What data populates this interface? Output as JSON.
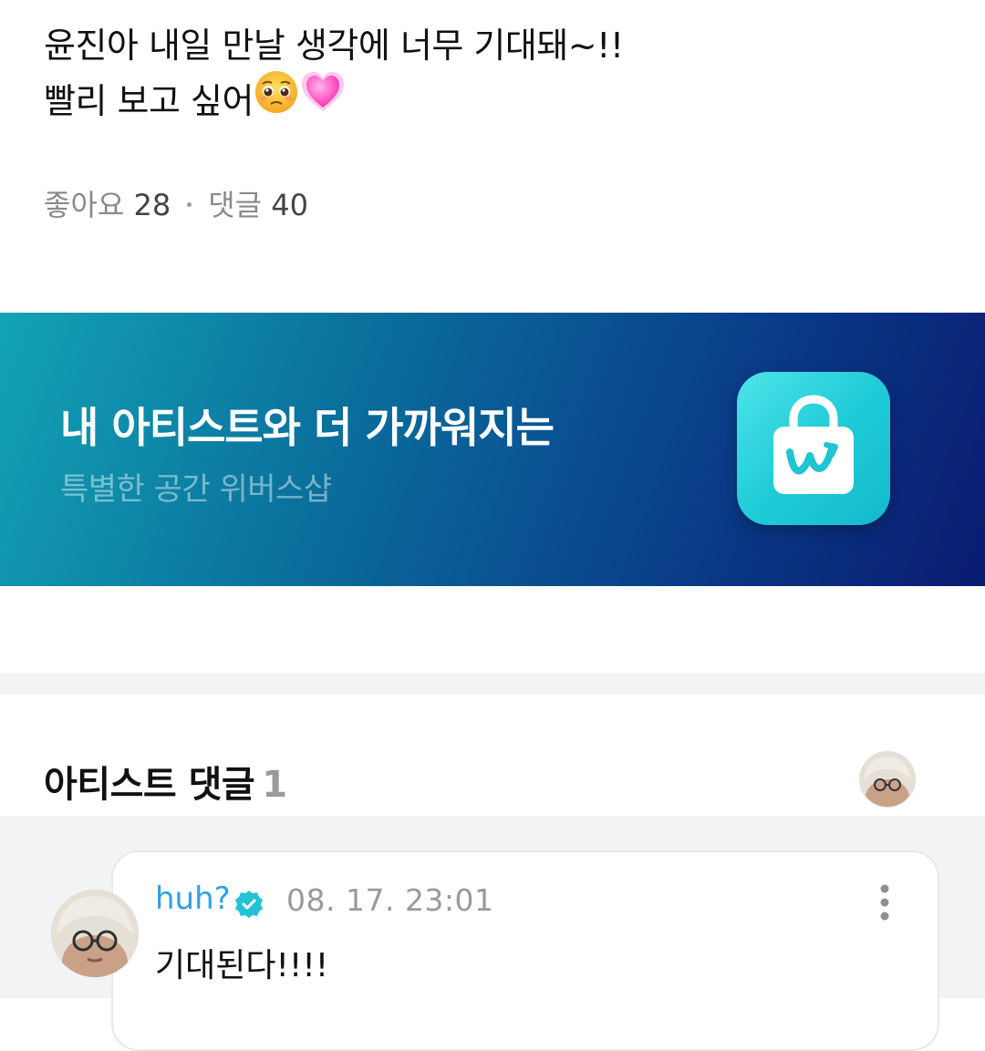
{
  "post": {
    "line1": "윤진아 내일 만날 생각에 너무 기대돼~!!",
    "line2": "빨리 보고 싶어",
    "emojis": [
      "pleading-face-icon",
      "growing-heart-icon"
    ]
  },
  "stats": {
    "likes_label": "좋아요",
    "likes_count": "28",
    "comments_label": "댓글",
    "comments_count": "40"
  },
  "banner": {
    "title": "내 아티스트와 더 가까워지는",
    "subtitle": "특별한 공간 위버스샵",
    "icon": "weverse-shop-bag-icon",
    "colors": {
      "gradient_start": "#13a3b5",
      "gradient_end": "#0a1a72",
      "icon_color": "#20ccd8"
    }
  },
  "artist_comments": {
    "title": "아티스트 댓글",
    "count": "1"
  },
  "comments": [
    {
      "author": "huh?",
      "verified": true,
      "time": "08. 17. 23:01",
      "text": "기대된다!!!!"
    }
  ],
  "colors": {
    "author": "#2fa1e4",
    "verified_badge": "#25c2d6",
    "muted_text": "#8a8a8a"
  }
}
